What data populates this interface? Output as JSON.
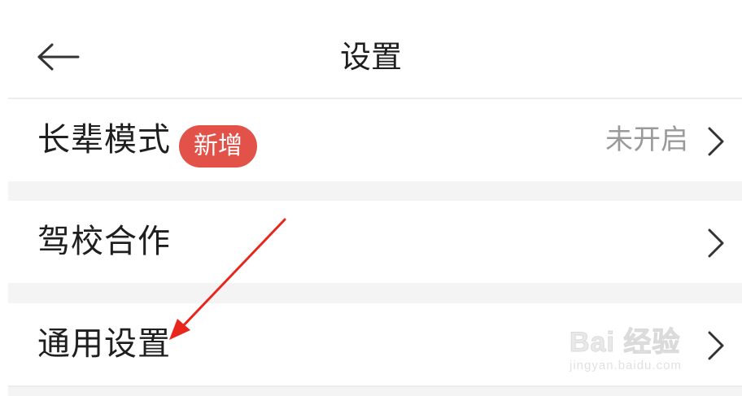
{
  "header": {
    "title": "设置",
    "back_icon": "back-arrow-icon"
  },
  "rows": [
    {
      "label": "长辈模式",
      "badge": "新增",
      "badge_color": "#e25248",
      "value": "未开启",
      "chevron": "chevron-right-icon"
    },
    {
      "label": "驾校合作",
      "chevron": "chevron-right-icon"
    },
    {
      "label": "通用设置",
      "chevron": "chevron-right-icon"
    }
  ],
  "annotation": {
    "arrow_color": "#e8261c",
    "points_to": "通用设置"
  },
  "watermark": {
    "brand": "Bai 经验",
    "url": "jingyan.baidu.com"
  }
}
